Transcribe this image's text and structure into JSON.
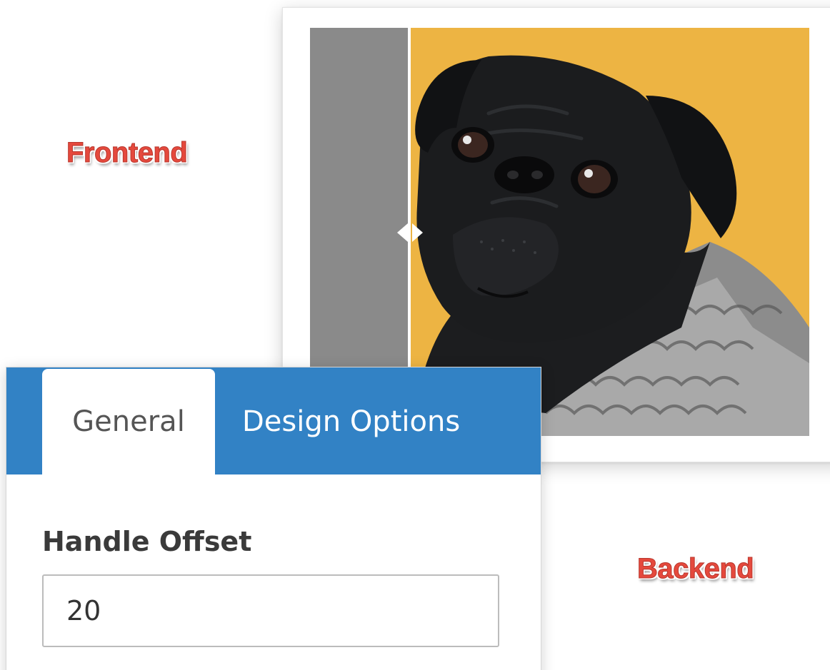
{
  "annotations": {
    "frontend": "Frontend",
    "backend": "Backend"
  },
  "preview": {
    "image_subject": "pug-in-knit-sweater",
    "before_panel_color": "#8a8a8a",
    "after_background_color": "#edb443",
    "handle_icon": "left-right-arrows-icon"
  },
  "backend": {
    "tabs": [
      {
        "label": "General",
        "active": true
      },
      {
        "label": "Design Options",
        "active": false
      }
    ],
    "accent_color": "#3282c5",
    "handle_offset": {
      "label": "Handle Offset",
      "value": "20"
    }
  }
}
